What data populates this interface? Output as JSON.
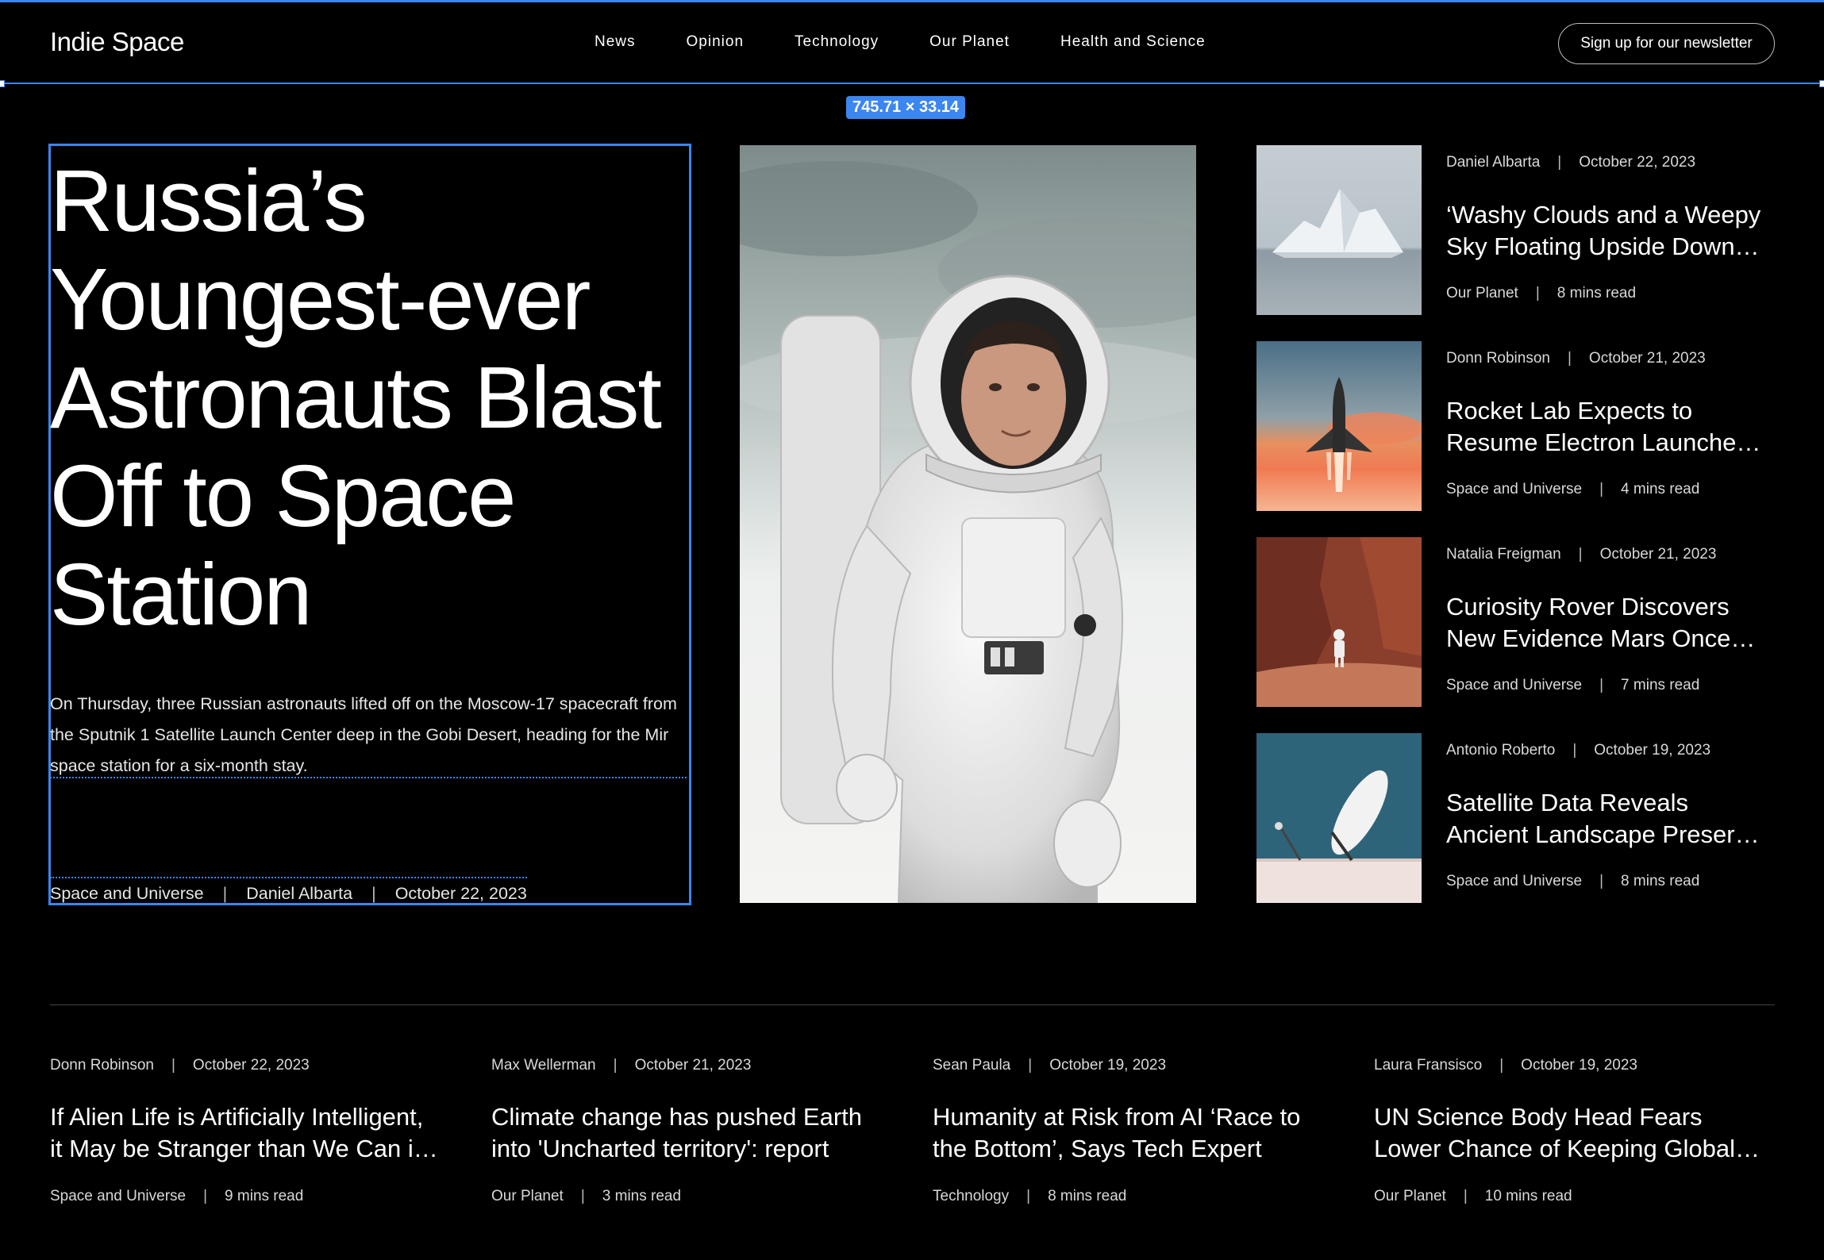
{
  "header": {
    "logo": "Indie Space",
    "nav": [
      "News",
      "Opinion",
      "Technology",
      "Our Planet",
      "Health and Science"
    ],
    "newsletter_button": "Sign up for our newsletter",
    "selection_label": "745.71 × 33.14"
  },
  "hero": {
    "title": "Russia’s Youngest-ever Astronauts Blast Off to Space Station",
    "description": "On Thursday, three Russian astronauts lifted off on the Moscow-17 spacecraft from the Sputnik 1 Satellite Launch Center deep in the Gobi Desert, heading for the Mir space station for a six-month stay.",
    "category": "Space and Universe",
    "author": "Daniel Albarta",
    "date": "October 22, 2023"
  },
  "side_articles": [
    {
      "author": "Daniel Albarta",
      "date": "October 22, 2023",
      "title_line1": "‘Washy Clouds and a Weepy",
      "title_line2": "Sky Floating Upside Down…",
      "category": "Our Planet",
      "read_time": "8 mins read",
      "image": "iceberg"
    },
    {
      "author": "Donn Robinson",
      "date": "October 21, 2023",
      "title_line1": "Rocket Lab Expects to",
      "title_line2": "Resume Electron Launche…",
      "category": "Space and Universe",
      "read_time": "4 mins read",
      "image": "space-shuttle"
    },
    {
      "author": "Natalia Freigman",
      "date": "October 21, 2023",
      "title_line1": "Curiosity Rover Discovers",
      "title_line2": "New Evidence Mars Once…",
      "category": "Space and Universe",
      "read_time": "7 mins read",
      "image": "astronaut-on-mars"
    },
    {
      "author": "Antonio Roberto",
      "date": "October 19, 2023",
      "title_line1": "Satellite Data Reveals",
      "title_line2": "Ancient Landscape Preser…",
      "category": "Space and Universe",
      "read_time": "8 mins read",
      "image": "satellite-dish"
    }
  ],
  "bottom_articles": [
    {
      "author": "Donn Robinson",
      "date": "October 22, 2023",
      "title_line1": "If Alien Life is Artificially Intelligent,",
      "title_line2": "it May be Stranger than We Can i…",
      "category": "Space and Universe",
      "read_time": "9 mins read"
    },
    {
      "author": "Max Wellerman",
      "date": "October 21, 2023",
      "title_line1": "Climate change has pushed Earth",
      "title_line2": "into 'Uncharted territory': report",
      "category": "Our Planet",
      "read_time": "3 mins read"
    },
    {
      "author": "Sean Paula",
      "date": "October 19, 2023",
      "title_line1": "Humanity at Risk from AI ‘Race to",
      "title_line2": "the Bottom’, Says Tech Expert",
      "category": "Technology",
      "read_time": "8 mins read"
    },
    {
      "author": "Laura Fransisco",
      "date": "October 19, 2023",
      "title_line1": "UN Science Body Head Fears",
      "title_line2": "Lower Chance of Keeping Global…",
      "category": "Our Planet",
      "read_time": "10 mins read"
    }
  ],
  "colors": {
    "background": "#000000",
    "text": "#ffffff",
    "selection": "#3b86f0"
  }
}
